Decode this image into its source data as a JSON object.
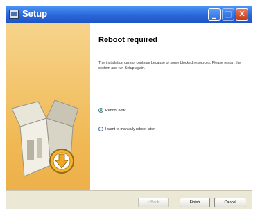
{
  "window": {
    "title": "Setup"
  },
  "titlebar": {
    "minimize": "_",
    "maximize": "□",
    "close": "✕"
  },
  "page": {
    "heading": "Reboot required",
    "description": "The installation cannot continue because of some blocked resources. Please restart the system and run Setup again."
  },
  "options": [
    {
      "label": "Reboot now",
      "checked": true
    },
    {
      "label": "I want to manually reboot later",
      "checked": false
    }
  ],
  "buttons": {
    "back": "< Back",
    "finish": "Finish",
    "cancel": "Cancel"
  }
}
